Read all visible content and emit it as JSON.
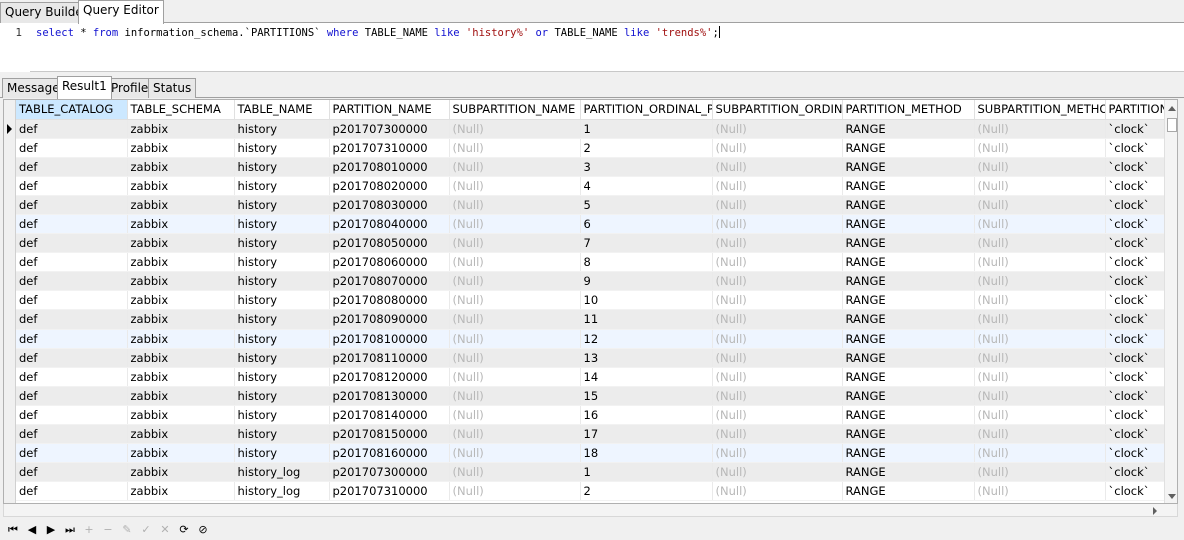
{
  "top_tabs": [
    {
      "label": "Query Builder",
      "active": false
    },
    {
      "label": "Query Editor",
      "active": true
    }
  ],
  "editor": {
    "line_number": "1",
    "sql": {
      "p1": "select",
      "p2": " * ",
      "p3": "from",
      "p4": " information_schema.`PARTITIONS` ",
      "p5": "where",
      "p6": " TABLE_NAME ",
      "p7": "like",
      "p8": " ",
      "p9": "'history%'",
      "p10": " ",
      "p11": "or",
      "p12": " TABLE_NAME ",
      "p13": "like",
      "p14": " ",
      "p15": "'trends%'",
      "p16": ";"
    }
  },
  "result_tabs": [
    {
      "label": "Message",
      "active": false
    },
    {
      "label": "Result1",
      "active": true
    },
    {
      "label": "Profile",
      "active": false
    },
    {
      "label": "Status",
      "active": false
    }
  ],
  "grid": {
    "columns": [
      "TABLE_CATALOG",
      "TABLE_SCHEMA",
      "TABLE_NAME",
      "PARTITION_NAME",
      "SUBPARTITION_NAME",
      "PARTITION_ORDINAL_PO",
      "SUBPARTITION_ORDINAL",
      "PARTITION_METHOD",
      "SUBPARTITION_METHOD",
      "PARTITION_"
    ],
    "null_text": "(Null)",
    "rows": [
      [
        "def",
        "zabbix",
        "history",
        "p201707300000",
        "(Null)",
        "1",
        "(Null)",
        "RANGE",
        "(Null)",
        "`clock`"
      ],
      [
        "def",
        "zabbix",
        "history",
        "p201707310000",
        "(Null)",
        "2",
        "(Null)",
        "RANGE",
        "(Null)",
        "`clock`"
      ],
      [
        "def",
        "zabbix",
        "history",
        "p201708010000",
        "(Null)",
        "3",
        "(Null)",
        "RANGE",
        "(Null)",
        "`clock`"
      ],
      [
        "def",
        "zabbix",
        "history",
        "p201708020000",
        "(Null)",
        "4",
        "(Null)",
        "RANGE",
        "(Null)",
        "`clock`"
      ],
      [
        "def",
        "zabbix",
        "history",
        "p201708030000",
        "(Null)",
        "5",
        "(Null)",
        "RANGE",
        "(Null)",
        "`clock`"
      ],
      [
        "def",
        "zabbix",
        "history",
        "p201708040000",
        "(Null)",
        "6",
        "(Null)",
        "RANGE",
        "(Null)",
        "`clock`"
      ],
      [
        "def",
        "zabbix",
        "history",
        "p201708050000",
        "(Null)",
        "7",
        "(Null)",
        "RANGE",
        "(Null)",
        "`clock`"
      ],
      [
        "def",
        "zabbix",
        "history",
        "p201708060000",
        "(Null)",
        "8",
        "(Null)",
        "RANGE",
        "(Null)",
        "`clock`"
      ],
      [
        "def",
        "zabbix",
        "history",
        "p201708070000",
        "(Null)",
        "9",
        "(Null)",
        "RANGE",
        "(Null)",
        "`clock`"
      ],
      [
        "def",
        "zabbix",
        "history",
        "p201708080000",
        "(Null)",
        "10",
        "(Null)",
        "RANGE",
        "(Null)",
        "`clock`"
      ],
      [
        "def",
        "zabbix",
        "history",
        "p201708090000",
        "(Null)",
        "11",
        "(Null)",
        "RANGE",
        "(Null)",
        "`clock`"
      ],
      [
        "def",
        "zabbix",
        "history",
        "p201708100000",
        "(Null)",
        "12",
        "(Null)",
        "RANGE",
        "(Null)",
        "`clock`"
      ],
      [
        "def",
        "zabbix",
        "history",
        "p201708110000",
        "(Null)",
        "13",
        "(Null)",
        "RANGE",
        "(Null)",
        "`clock`"
      ],
      [
        "def",
        "zabbix",
        "history",
        "p201708120000",
        "(Null)",
        "14",
        "(Null)",
        "RANGE",
        "(Null)",
        "`clock`"
      ],
      [
        "def",
        "zabbix",
        "history",
        "p201708130000",
        "(Null)",
        "15",
        "(Null)",
        "RANGE",
        "(Null)",
        "`clock`"
      ],
      [
        "def",
        "zabbix",
        "history",
        "p201708140000",
        "(Null)",
        "16",
        "(Null)",
        "RANGE",
        "(Null)",
        "`clock`"
      ],
      [
        "def",
        "zabbix",
        "history",
        "p201708150000",
        "(Null)",
        "17",
        "(Null)",
        "RANGE",
        "(Null)",
        "`clock`"
      ],
      [
        "def",
        "zabbix",
        "history",
        "p201708160000",
        "(Null)",
        "18",
        "(Null)",
        "RANGE",
        "(Null)",
        "`clock`"
      ],
      [
        "def",
        "zabbix",
        "history_log",
        "p201707300000",
        "(Null)",
        "1",
        "(Null)",
        "RANGE",
        "(Null)",
        "`clock`"
      ],
      [
        "def",
        "zabbix",
        "history_log",
        "p201707310000",
        "(Null)",
        "2",
        "(Null)",
        "RANGE",
        "(Null)",
        "`clock`"
      ]
    ]
  },
  "navbar": {
    "first": "⏮",
    "prev": "◀",
    "next": "▶",
    "last": "⏭",
    "add": "+",
    "delete": "−",
    "edit": "✎",
    "apply": "✓",
    "cancel": "✕",
    "refresh": "⟳",
    "stop": "⊘"
  }
}
